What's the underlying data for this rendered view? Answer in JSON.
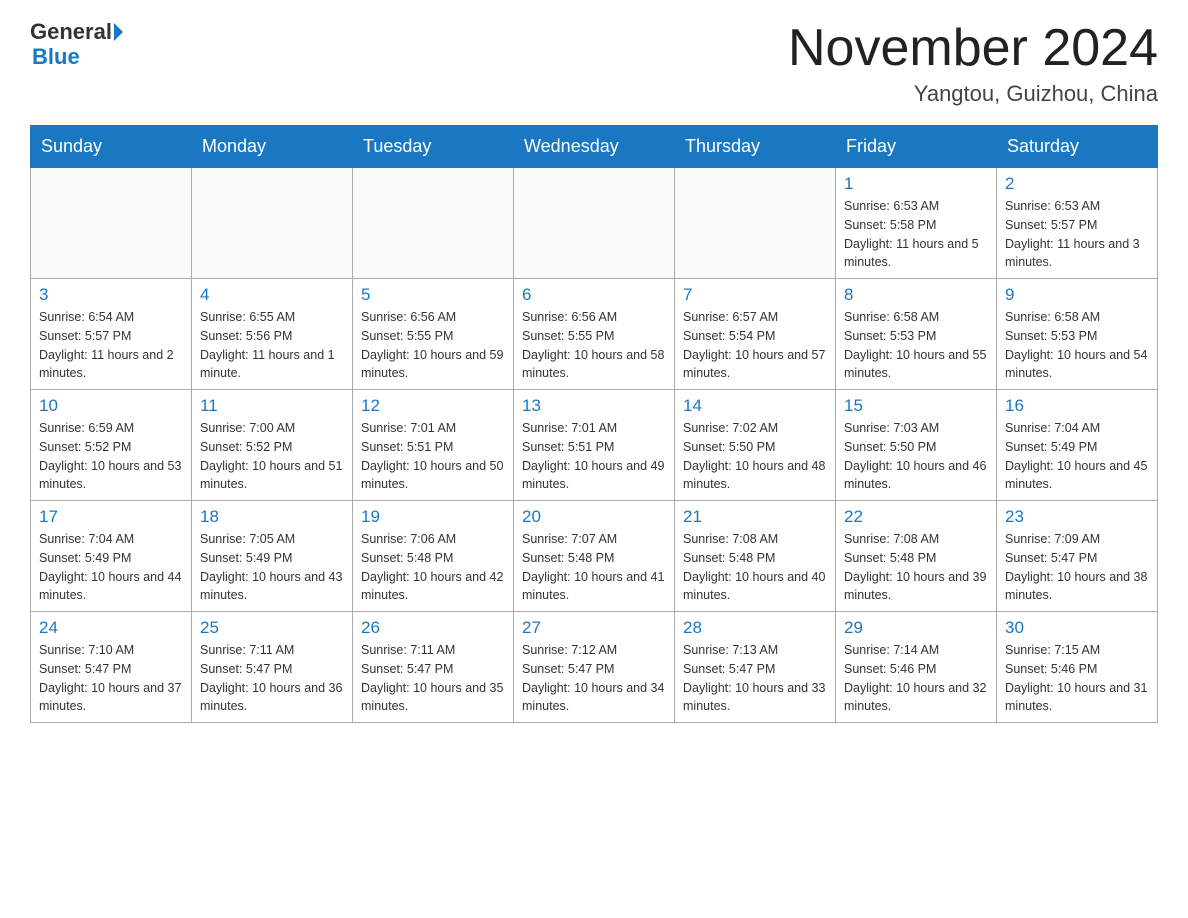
{
  "header": {
    "logo_general": "General",
    "logo_blue": "Blue",
    "month_title": "November 2024",
    "location": "Yangtou, Guizhou, China"
  },
  "weekdays": [
    "Sunday",
    "Monday",
    "Tuesday",
    "Wednesday",
    "Thursday",
    "Friday",
    "Saturday"
  ],
  "weeks": [
    [
      {
        "day": "",
        "sunrise": "",
        "sunset": "",
        "daylight": ""
      },
      {
        "day": "",
        "sunrise": "",
        "sunset": "",
        "daylight": ""
      },
      {
        "day": "",
        "sunrise": "",
        "sunset": "",
        "daylight": ""
      },
      {
        "day": "",
        "sunrise": "",
        "sunset": "",
        "daylight": ""
      },
      {
        "day": "",
        "sunrise": "",
        "sunset": "",
        "daylight": ""
      },
      {
        "day": "1",
        "sunrise": "Sunrise: 6:53 AM",
        "sunset": "Sunset: 5:58 PM",
        "daylight": "Daylight: 11 hours and 5 minutes."
      },
      {
        "day": "2",
        "sunrise": "Sunrise: 6:53 AM",
        "sunset": "Sunset: 5:57 PM",
        "daylight": "Daylight: 11 hours and 3 minutes."
      }
    ],
    [
      {
        "day": "3",
        "sunrise": "Sunrise: 6:54 AM",
        "sunset": "Sunset: 5:57 PM",
        "daylight": "Daylight: 11 hours and 2 minutes."
      },
      {
        "day": "4",
        "sunrise": "Sunrise: 6:55 AM",
        "sunset": "Sunset: 5:56 PM",
        "daylight": "Daylight: 11 hours and 1 minute."
      },
      {
        "day": "5",
        "sunrise": "Sunrise: 6:56 AM",
        "sunset": "Sunset: 5:55 PM",
        "daylight": "Daylight: 10 hours and 59 minutes."
      },
      {
        "day": "6",
        "sunrise": "Sunrise: 6:56 AM",
        "sunset": "Sunset: 5:55 PM",
        "daylight": "Daylight: 10 hours and 58 minutes."
      },
      {
        "day": "7",
        "sunrise": "Sunrise: 6:57 AM",
        "sunset": "Sunset: 5:54 PM",
        "daylight": "Daylight: 10 hours and 57 minutes."
      },
      {
        "day": "8",
        "sunrise": "Sunrise: 6:58 AM",
        "sunset": "Sunset: 5:53 PM",
        "daylight": "Daylight: 10 hours and 55 minutes."
      },
      {
        "day": "9",
        "sunrise": "Sunrise: 6:58 AM",
        "sunset": "Sunset: 5:53 PM",
        "daylight": "Daylight: 10 hours and 54 minutes."
      }
    ],
    [
      {
        "day": "10",
        "sunrise": "Sunrise: 6:59 AM",
        "sunset": "Sunset: 5:52 PM",
        "daylight": "Daylight: 10 hours and 53 minutes."
      },
      {
        "day": "11",
        "sunrise": "Sunrise: 7:00 AM",
        "sunset": "Sunset: 5:52 PM",
        "daylight": "Daylight: 10 hours and 51 minutes."
      },
      {
        "day": "12",
        "sunrise": "Sunrise: 7:01 AM",
        "sunset": "Sunset: 5:51 PM",
        "daylight": "Daylight: 10 hours and 50 minutes."
      },
      {
        "day": "13",
        "sunrise": "Sunrise: 7:01 AM",
        "sunset": "Sunset: 5:51 PM",
        "daylight": "Daylight: 10 hours and 49 minutes."
      },
      {
        "day": "14",
        "sunrise": "Sunrise: 7:02 AM",
        "sunset": "Sunset: 5:50 PM",
        "daylight": "Daylight: 10 hours and 48 minutes."
      },
      {
        "day": "15",
        "sunrise": "Sunrise: 7:03 AM",
        "sunset": "Sunset: 5:50 PM",
        "daylight": "Daylight: 10 hours and 46 minutes."
      },
      {
        "day": "16",
        "sunrise": "Sunrise: 7:04 AM",
        "sunset": "Sunset: 5:49 PM",
        "daylight": "Daylight: 10 hours and 45 minutes."
      }
    ],
    [
      {
        "day": "17",
        "sunrise": "Sunrise: 7:04 AM",
        "sunset": "Sunset: 5:49 PM",
        "daylight": "Daylight: 10 hours and 44 minutes."
      },
      {
        "day": "18",
        "sunrise": "Sunrise: 7:05 AM",
        "sunset": "Sunset: 5:49 PM",
        "daylight": "Daylight: 10 hours and 43 minutes."
      },
      {
        "day": "19",
        "sunrise": "Sunrise: 7:06 AM",
        "sunset": "Sunset: 5:48 PM",
        "daylight": "Daylight: 10 hours and 42 minutes."
      },
      {
        "day": "20",
        "sunrise": "Sunrise: 7:07 AM",
        "sunset": "Sunset: 5:48 PM",
        "daylight": "Daylight: 10 hours and 41 minutes."
      },
      {
        "day": "21",
        "sunrise": "Sunrise: 7:08 AM",
        "sunset": "Sunset: 5:48 PM",
        "daylight": "Daylight: 10 hours and 40 minutes."
      },
      {
        "day": "22",
        "sunrise": "Sunrise: 7:08 AM",
        "sunset": "Sunset: 5:48 PM",
        "daylight": "Daylight: 10 hours and 39 minutes."
      },
      {
        "day": "23",
        "sunrise": "Sunrise: 7:09 AM",
        "sunset": "Sunset: 5:47 PM",
        "daylight": "Daylight: 10 hours and 38 minutes."
      }
    ],
    [
      {
        "day": "24",
        "sunrise": "Sunrise: 7:10 AM",
        "sunset": "Sunset: 5:47 PM",
        "daylight": "Daylight: 10 hours and 37 minutes."
      },
      {
        "day": "25",
        "sunrise": "Sunrise: 7:11 AM",
        "sunset": "Sunset: 5:47 PM",
        "daylight": "Daylight: 10 hours and 36 minutes."
      },
      {
        "day": "26",
        "sunrise": "Sunrise: 7:11 AM",
        "sunset": "Sunset: 5:47 PM",
        "daylight": "Daylight: 10 hours and 35 minutes."
      },
      {
        "day": "27",
        "sunrise": "Sunrise: 7:12 AM",
        "sunset": "Sunset: 5:47 PM",
        "daylight": "Daylight: 10 hours and 34 minutes."
      },
      {
        "day": "28",
        "sunrise": "Sunrise: 7:13 AM",
        "sunset": "Sunset: 5:47 PM",
        "daylight": "Daylight: 10 hours and 33 minutes."
      },
      {
        "day": "29",
        "sunrise": "Sunrise: 7:14 AM",
        "sunset": "Sunset: 5:46 PM",
        "daylight": "Daylight: 10 hours and 32 minutes."
      },
      {
        "day": "30",
        "sunrise": "Sunrise: 7:15 AM",
        "sunset": "Sunset: 5:46 PM",
        "daylight": "Daylight: 10 hours and 31 minutes."
      }
    ]
  ]
}
